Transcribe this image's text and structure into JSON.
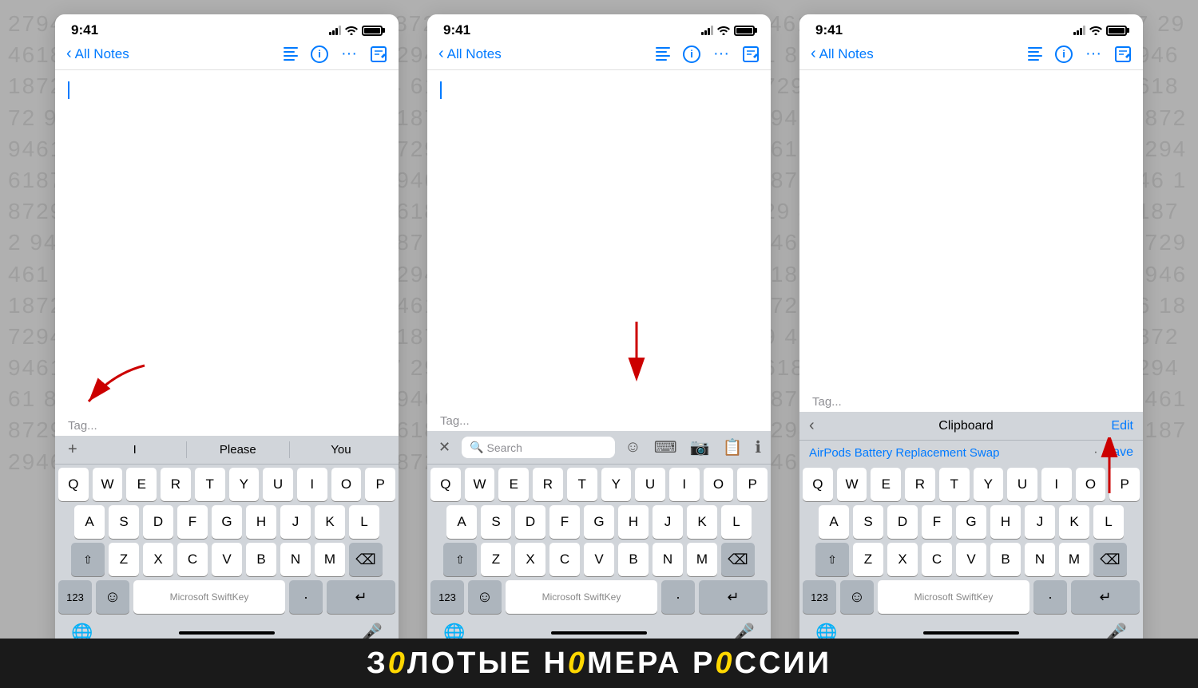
{
  "background": {
    "numbers": "279461872946187294618729461872946187294618729461872946187294618729461872946187294618729461872946187294618729461872946187294618729461872946187294618729461872946187294618729461872946187294618729461872946187294618729461872946187294618729461872946187294618729461872946187294618729461872946187294618729461872946187294618729461872946187294618729461872946187294618729461872946187294618729461872946187294618729461872946187294618729461872946187294618729461872946187294618729461872946"
  },
  "screens": [
    {
      "id": "screen1",
      "statusBar": {
        "time": "9:41",
        "battery": "full"
      },
      "navBar": {
        "backText": "All Notes",
        "actions": [
          "list",
          "info",
          "more",
          "compose"
        ]
      },
      "noteContent": {
        "hasCursor": true,
        "tagPlaceholder": "Tag..."
      },
      "keyboard": {
        "predictive": [
          "+",
          "I",
          "Please",
          "You"
        ],
        "rows": [
          [
            "Q",
            "W",
            "E",
            "R",
            "T",
            "Y",
            "U",
            "I",
            "O",
            "P"
          ],
          [
            "A",
            "S",
            "D",
            "F",
            "G",
            "H",
            "J",
            "K",
            "L"
          ],
          [
            "⇧",
            "Z",
            "X",
            "C",
            "V",
            "B",
            "N",
            "M",
            "⌫"
          ],
          [
            "123",
            "😊",
            "Microsoft SwiftKey",
            "'",
            "↵"
          ]
        ],
        "bottomIcons": [
          "🌐",
          "🎤"
        ]
      },
      "arrow": {
        "points": "plus_button",
        "direction": "top-right"
      }
    },
    {
      "id": "screen2",
      "statusBar": {
        "time": "9:41",
        "battery": "full"
      },
      "navBar": {
        "backText": "All Notes",
        "actions": [
          "list",
          "info",
          "more",
          "compose"
        ]
      },
      "noteContent": {
        "hasCursor": true,
        "tagPlaceholder": "Tag..."
      },
      "keyboard": {
        "toolbar": {
          "close": "×",
          "searchPlaceholder": "Search",
          "icons": [
            "😊",
            "⌨",
            "📷",
            "📋",
            "ℹ"
          ]
        },
        "rows": [
          [
            "Q",
            "W",
            "E",
            "R",
            "T",
            "Y",
            "U",
            "I",
            "O",
            "P"
          ],
          [
            "A",
            "S",
            "D",
            "F",
            "G",
            "H",
            "J",
            "K",
            "L"
          ],
          [
            "⇧",
            "Z",
            "X",
            "C",
            "V",
            "B",
            "N",
            "M",
            "⌫"
          ],
          [
            "123",
            "😊",
            "Microsoft SwiftKey",
            "'",
            "↵"
          ]
        ],
        "bottomIcons": [
          "🌐",
          "🎤"
        ]
      },
      "arrow": {
        "points": "clipboard_icon",
        "direction": "top"
      }
    },
    {
      "id": "screen3",
      "statusBar": {
        "time": "9:41",
        "battery": "full"
      },
      "navBar": {
        "backText": "All Notes",
        "actions": [
          "list",
          "info",
          "more",
          "compose"
        ]
      },
      "noteContent": {
        "hasCursor": false,
        "tagPlaceholder": "Tag..."
      },
      "keyboard": {
        "clipboardBar": {
          "chevron": "<",
          "label": "Clipboard",
          "editLabel": "Edit"
        },
        "clipboardContent": {
          "text": "AirPods Battery Replacement Swap",
          "dots": "·",
          "saveLabel": "Save"
        },
        "rows": [
          [
            "Q",
            "W",
            "E",
            "R",
            "T",
            "Y",
            "U",
            "I",
            "O",
            "P"
          ],
          [
            "A",
            "S",
            "D",
            "F",
            "G",
            "H",
            "J",
            "K",
            "L"
          ],
          [
            "⇧",
            "Z",
            "X",
            "C",
            "V",
            "B",
            "N",
            "M",
            "⌫"
          ],
          [
            "123",
            "😊",
            "Microsoft SwiftKey",
            "'",
            "↵"
          ]
        ],
        "bottomIcons": [
          "🌐",
          "🎤"
        ]
      },
      "arrow": {
        "points": "save_button",
        "direction": "bottom"
      }
    }
  ],
  "brandBar": {
    "text": "З0ЛОТЫЕ Н0МЕРА Р0ССИИ",
    "textParts": [
      "З",
      "0",
      "ЛОТЫЕ Н",
      "0",
      "МЕРА Р",
      "0",
      "ССИИ"
    ]
  }
}
